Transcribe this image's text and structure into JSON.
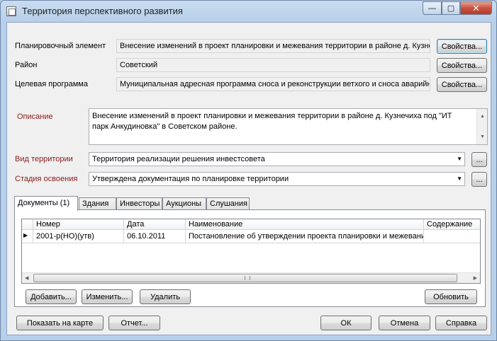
{
  "window": {
    "title": "Территория перспективного развития",
    "minimize_glyph": "—",
    "maximize_glyph": "▢",
    "close_glyph": "✕"
  },
  "fields": {
    "plan_element": {
      "label": "Планировочный элемент",
      "value": "Внесение изменений в проект планировки и межевания территории  в  районе  д. Кузнечиха",
      "button": "Свойства..."
    },
    "district": {
      "label": "Район",
      "value": "Советский",
      "button": "Свойства..."
    },
    "target_program": {
      "label": "Целевая программа",
      "value": "Муниципальная адресная программа сноса и реконструкции ветхого и сноса аварийного жилья",
      "button": "Свойства..."
    }
  },
  "description": {
    "label": "Описание",
    "line1": "Внесение изменений в проект планировки и межевания территории  в  районе  д. Кузнечиха  под  \"ИТ",
    "line2": "парк  Анкудиновка\"  в  Советском  районе."
  },
  "territory_type": {
    "label": "Вид территории",
    "value": "Территория реализации решения инвестсовета",
    "button": "..."
  },
  "stage": {
    "label": "Стадия освоения",
    "value": "Утверждена документация по планировке территории",
    "button": "..."
  },
  "tabs": [
    {
      "label": "Документы (1)",
      "active": true
    },
    {
      "label": "Здания"
    },
    {
      "label": "Инвесторы"
    },
    {
      "label": "Аукционы"
    },
    {
      "label": "Слушания"
    }
  ],
  "grid": {
    "columns": [
      "Номер",
      "Дата",
      "Наименование",
      "Содержание"
    ],
    "rows": [
      {
        "number": "2001-р(НО)(утв)",
        "date": "06.10.2011",
        "name": "Постановление об утверждении проекта планировки и межевания территории",
        "content": ""
      }
    ]
  },
  "tab_buttons": {
    "add": "Добавить...",
    "edit": "Изменить...",
    "delete": "Удалить",
    "refresh": "Обновить"
  },
  "footer": {
    "show_map": "Показать на карте",
    "report": "Отчет...",
    "ok": "ОК",
    "cancel": "Отмена",
    "help": "Справка"
  }
}
